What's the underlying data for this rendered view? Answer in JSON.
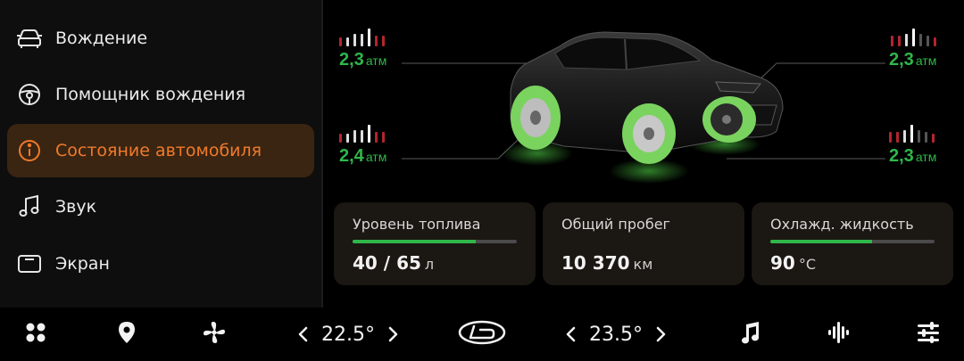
{
  "sidebar": {
    "items": [
      {
        "label": "Вождение",
        "icon": "car-icon",
        "active": false
      },
      {
        "label": "Помощник вождения",
        "icon": "steering-wheel-icon",
        "active": false
      },
      {
        "label": "Состояние автомобиля",
        "icon": "info-icon",
        "active": true
      },
      {
        "label": "Звук",
        "icon": "music-note-icon",
        "active": false
      },
      {
        "label": "Экран",
        "icon": "screen-icon",
        "active": false
      }
    ]
  },
  "tires": {
    "front_left": {
      "pressure": "2,3",
      "unit": "атм"
    },
    "rear_left": {
      "pressure": "2,4",
      "unit": "атм"
    },
    "front_right": {
      "pressure": "2,3",
      "unit": "атм"
    },
    "rear_right": {
      "pressure": "2,3",
      "unit": "атм"
    }
  },
  "cards": {
    "fuel": {
      "title": "Уровень топлива",
      "value": "40 / 65",
      "unit": "л",
      "level": 0.75
    },
    "mileage": {
      "title": "Общий пробег",
      "value": "10 370",
      "unit": "км"
    },
    "coolant": {
      "title": "Охлажд. жидкость",
      "value": "90",
      "unit": "°C",
      "level": 0.62
    }
  },
  "climate": {
    "left_temp": "22.5°",
    "right_temp": "23.5°"
  },
  "colors": {
    "accent": "#f07a2a",
    "active_bg": "#3a2512",
    "ok_green": "#2fb74a",
    "warn_red": "#b3262e"
  },
  "bottom_bar": {
    "icons": [
      "apps-icon",
      "location-pin-icon",
      "fan-icon",
      "lada-logo-icon",
      "music-note-icon",
      "equalizer-icon",
      "sliders-icon"
    ]
  }
}
